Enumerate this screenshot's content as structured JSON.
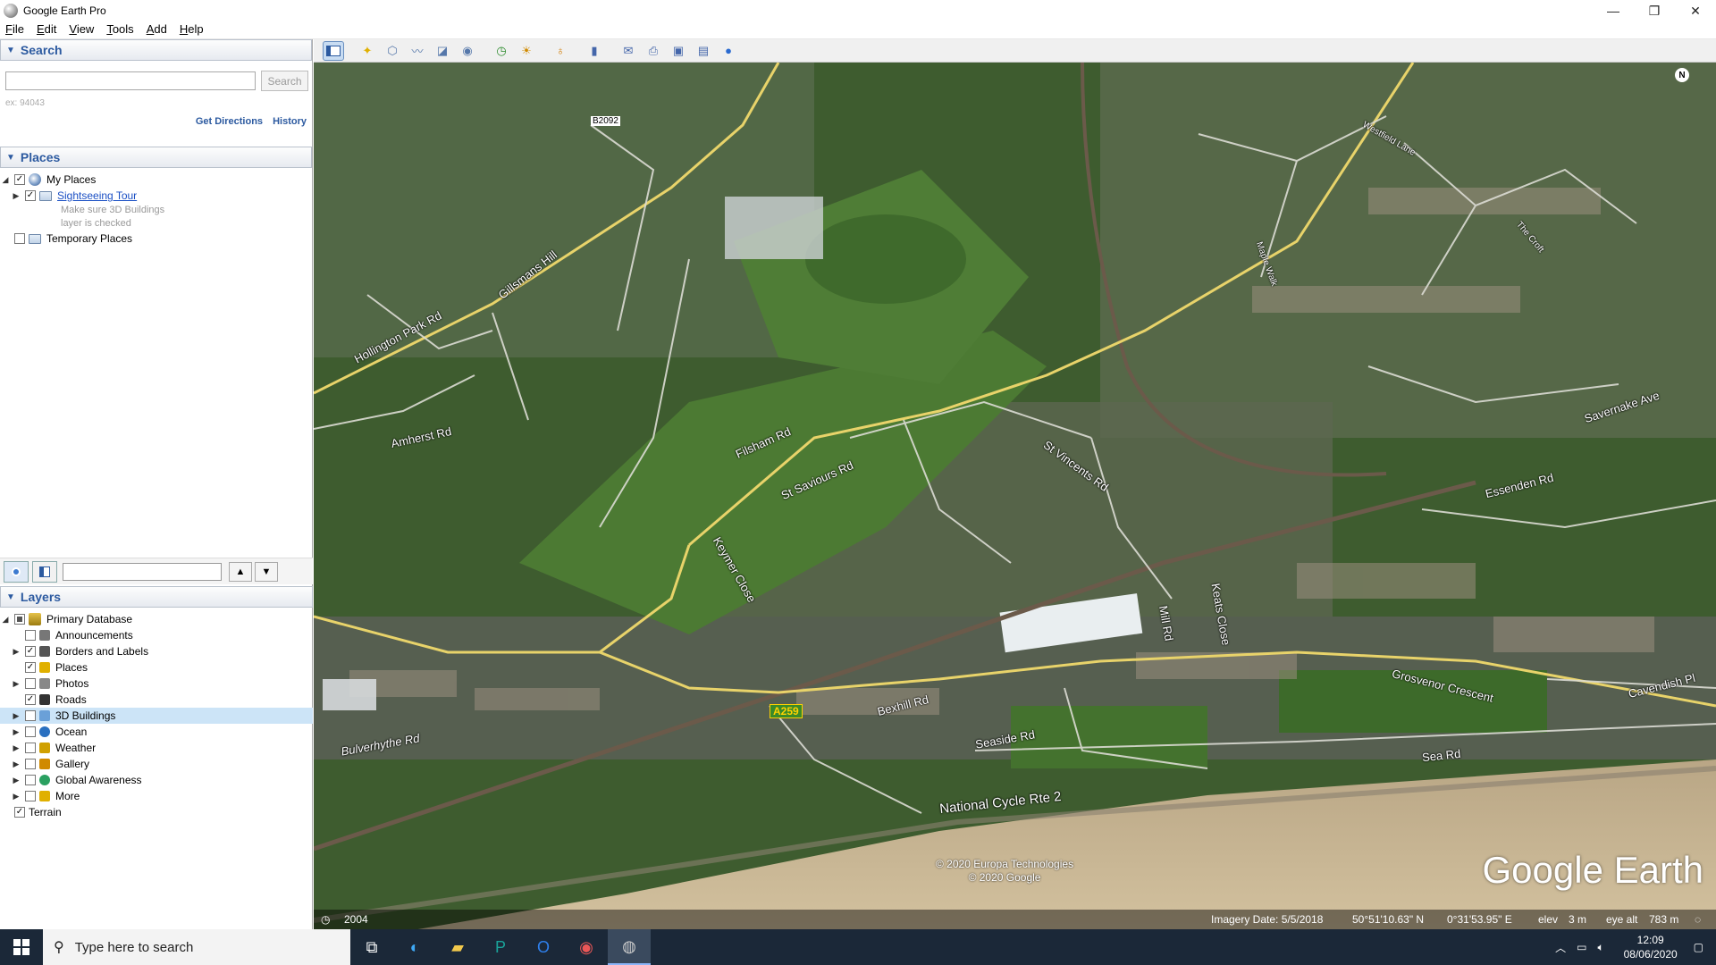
{
  "window": {
    "title": "Google Earth Pro",
    "minimize": "—",
    "restore": "❐",
    "close": "✕"
  },
  "menu": [
    "File",
    "Edit",
    "View",
    "Tools",
    "Add",
    "Help"
  ],
  "search": {
    "header": "Search",
    "placeholder": "",
    "button": "Search",
    "hint": "ex: 94043",
    "get_directions": "Get Directions",
    "history": "History"
  },
  "places": {
    "header": "Places",
    "my_places": "My Places",
    "sightseeing": "Sightseeing Tour",
    "note_line1": "Make sure 3D Buildings",
    "note_line2": "layer is checked",
    "temporary": "Temporary Places"
  },
  "layers": {
    "header": "Layers",
    "primary": "Primary Database",
    "items": [
      {
        "label": "Announcements",
        "checked": false,
        "expandable": false
      },
      {
        "label": "Borders and Labels",
        "checked": true,
        "expandable": true
      },
      {
        "label": "Places",
        "checked": true,
        "expandable": false
      },
      {
        "label": "Photos",
        "checked": false,
        "expandable": true
      },
      {
        "label": "Roads",
        "checked": true,
        "expandable": false
      },
      {
        "label": "3D Buildings",
        "checked": false,
        "expandable": true
      },
      {
        "label": "Ocean",
        "checked": false,
        "expandable": true
      },
      {
        "label": "Weather",
        "checked": false,
        "expandable": true
      },
      {
        "label": "Gallery",
        "checked": false,
        "expandable": true
      },
      {
        "label": "Global Awareness",
        "checked": false,
        "expandable": true
      },
      {
        "label": "More",
        "checked": false,
        "expandable": true
      }
    ],
    "terrain": "Terrain"
  },
  "map": {
    "labels": {
      "b2092": "B2092",
      "hollington": "Hollington Park Rd",
      "gillsmans": "Gillsmans Hill",
      "amherst": "Amherst Rd",
      "filsham": "Filsham Rd",
      "st_saviours": "St Saviours Rd",
      "keymer": "Keymer Close",
      "st_vincents": "St Vincents Rd",
      "essenden": "Essenden Rd",
      "savernake": "Savernake Ave",
      "westfield": "Westfield Lane",
      "hollyfield": "The Croft",
      "maple": "Maple Walk",
      "bulverhythe": "Bulverhythe Rd",
      "bexhill": "Bexhill Rd",
      "seaside": "Seaside Rd",
      "cycle": "National Cycle Rte 2",
      "sea_rd": "Sea Rd",
      "grosvenor": "Grosvenor Crescent",
      "cavendish": "Cavendish Pl",
      "a259": "A259",
      "mill": "Mill Rd",
      "keats": "Keats Close"
    },
    "copyright1": "© 2020 Europa Technologies",
    "copyright2": "© 2020 Google",
    "watermark": "Google Earth",
    "north": "N",
    "status": {
      "year": "2004",
      "imagery": "Imagery Date: 5/5/2018",
      "lat": "50°51'10.63\" N",
      "lon": "0°31'53.95\" E",
      "elev_label": "elev",
      "elev": "3 m",
      "eye_label": "eye alt",
      "eye": "783 m"
    }
  },
  "taskbar": {
    "search_placeholder": "Type here to search",
    "time": "12:09",
    "date": "08/06/2020"
  },
  "colors": {
    "road": "#e8d36a",
    "grass": "#4d7a34",
    "beach": "#cbb795",
    "accent": "#2c5aa0"
  }
}
